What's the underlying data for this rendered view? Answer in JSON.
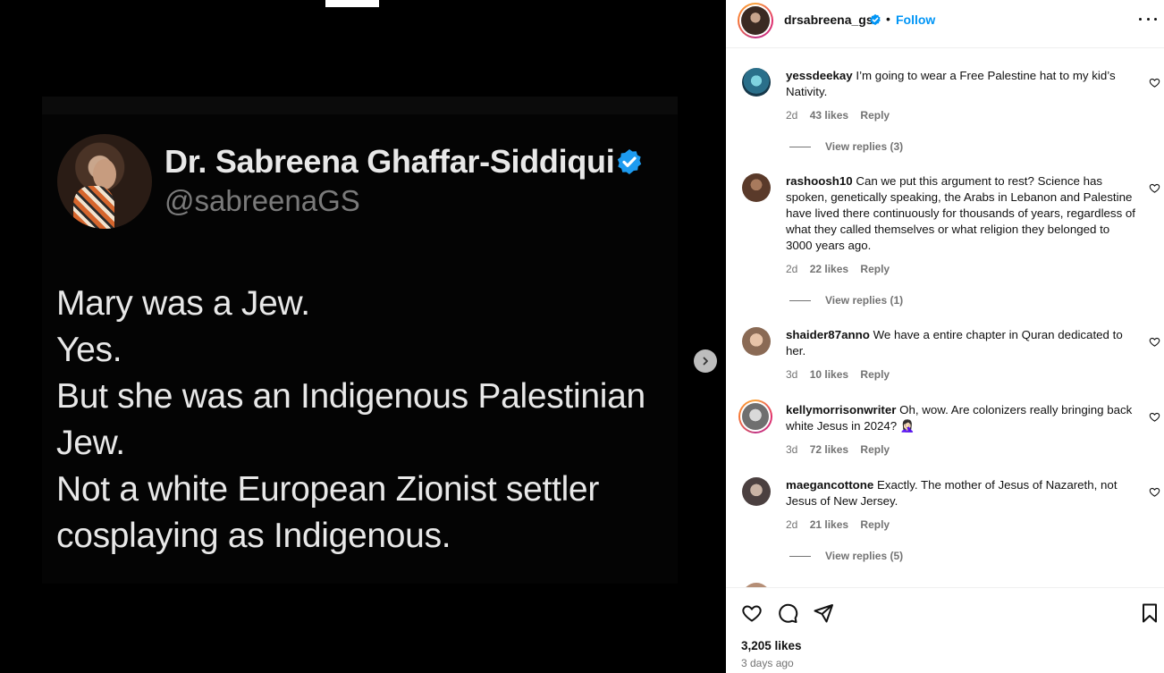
{
  "media": {
    "tweet": {
      "display_name": "Dr. Sabreena Ghaffar-Siddiqui",
      "handle": "@sabreenaGS",
      "lines": [
        "Mary was a Jew.",
        "Yes.",
        "But she was an Indigenous Palestinian",
        "Jew.",
        "Not a white European Zionist settler",
        "cosplaying as Indigenous."
      ],
      "verified_icon": "verified-badge-icon"
    },
    "next_icon": "chevron-right-icon"
  },
  "header": {
    "username": "drsabreena_gs",
    "dot": "•",
    "follow_label": "Follow",
    "more_icon": "more-horizontal-icon"
  },
  "comments": [
    {
      "username": "yessdeekay",
      "text": "I’m going to wear a Free Palestine hat to my kid’s Nativity.",
      "age": "2d",
      "likes": "43 likes",
      "reply_label": "Reply",
      "view_replies": "View replies (3)"
    },
    {
      "username": "rashoosh10",
      "text": "Can we put this argument to rest? Science has spoken, genetically speaking, the Arabs in Lebanon and Palestine have lived there continuously for thousands of years, regardless of what they called themselves or what religion they belonged to 3000 years ago.",
      "age": "2d",
      "likes": "22 likes",
      "reply_label": "Reply",
      "view_replies": "View replies (1)"
    },
    {
      "username": "shaider87anno",
      "text": "We have a entire chapter in Quran dedicated to her.",
      "age": "3d",
      "likes": "10 likes",
      "reply_label": "Reply",
      "view_replies": ""
    },
    {
      "username": "kellymorrisonwriter",
      "text": "Oh, wow. Are colonizers really bringing back white Jesus in 2024? 🤦🏻‍♀️",
      "age": "3d",
      "likes": "72 likes",
      "reply_label": "Reply",
      "view_replies": ""
    },
    {
      "username": "maegancottone",
      "text": "Exactly. The mother of Jesus of Nazareth, not Jesus of New Jersey.",
      "age": "2d",
      "likes": "21 likes",
      "reply_label": "Reply",
      "view_replies": "View replies (5)"
    }
  ],
  "actions": {
    "like_icon": "heart-icon",
    "comment_icon": "comment-icon",
    "share_icon": "send-icon",
    "save_icon": "bookmark-icon",
    "likes_count": "3,205 likes",
    "time_ago": "3 days ago"
  },
  "colors": {
    "accent_blue": "#0095f6",
    "verified_blue": "#1d9bf0",
    "muted_text": "#737373"
  }
}
